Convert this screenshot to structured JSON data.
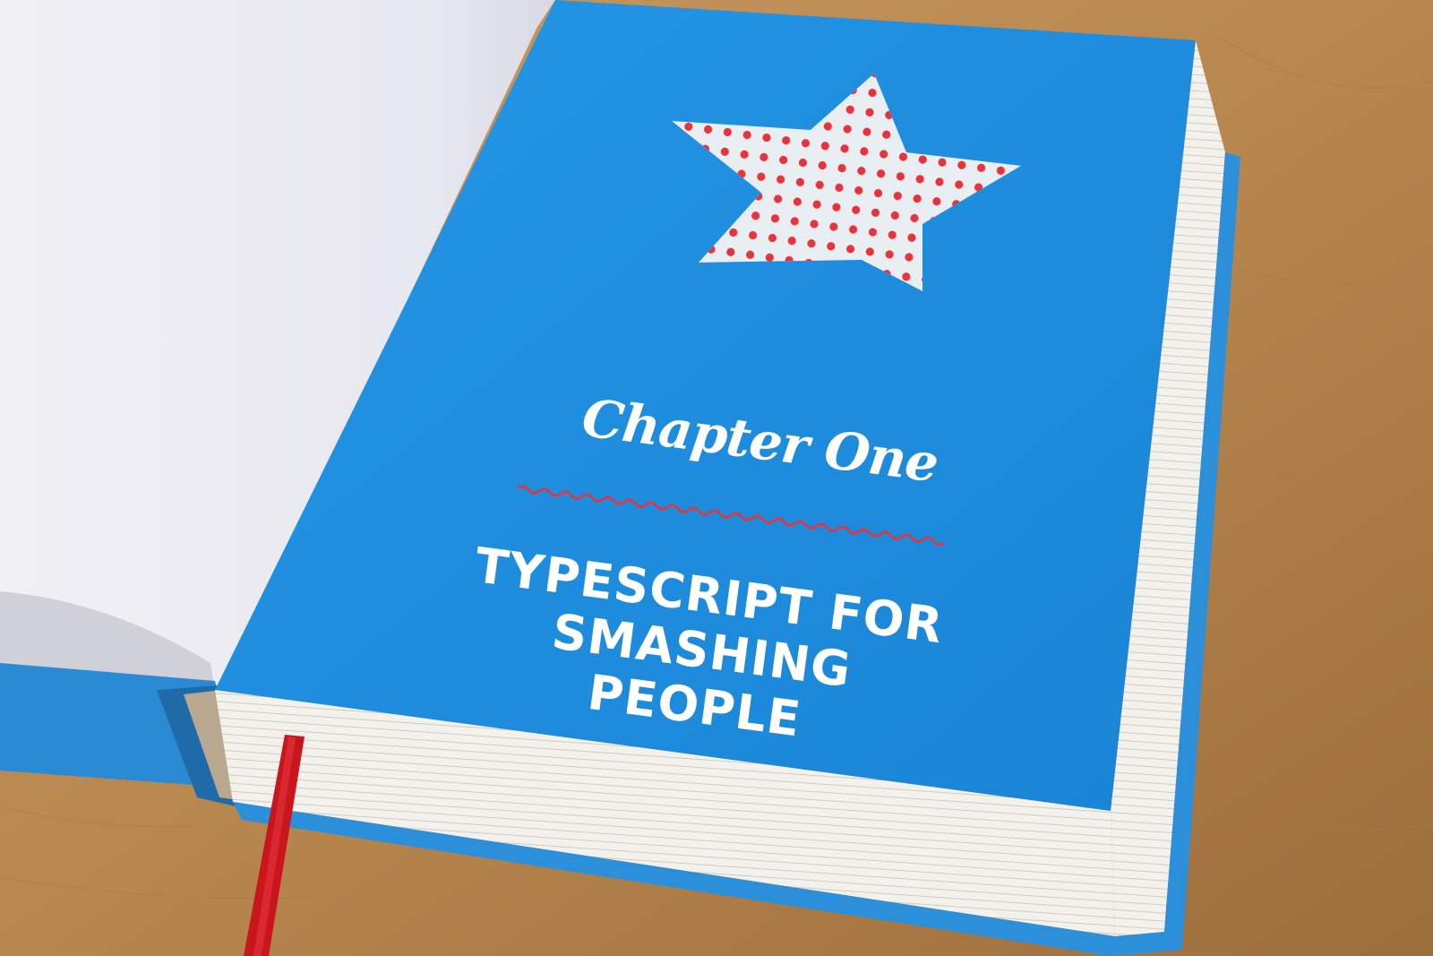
{
  "page": {
    "chapter_label": "Chapter One",
    "title_line_1": "TYPESCRIPT FOR",
    "title_line_2": "SMASHING PEOPLE"
  },
  "colors": {
    "cover_blue": "#1f8fe0",
    "star_fill": "#e9eef2",
    "dot_red": "#e8333b",
    "ribbon_red": "#c9161d",
    "table_wood": "#b98a55",
    "left_page": "#ececf1"
  },
  "icons": {
    "star": "polka-dot-star-icon",
    "divider": "wavy-line-icon"
  }
}
